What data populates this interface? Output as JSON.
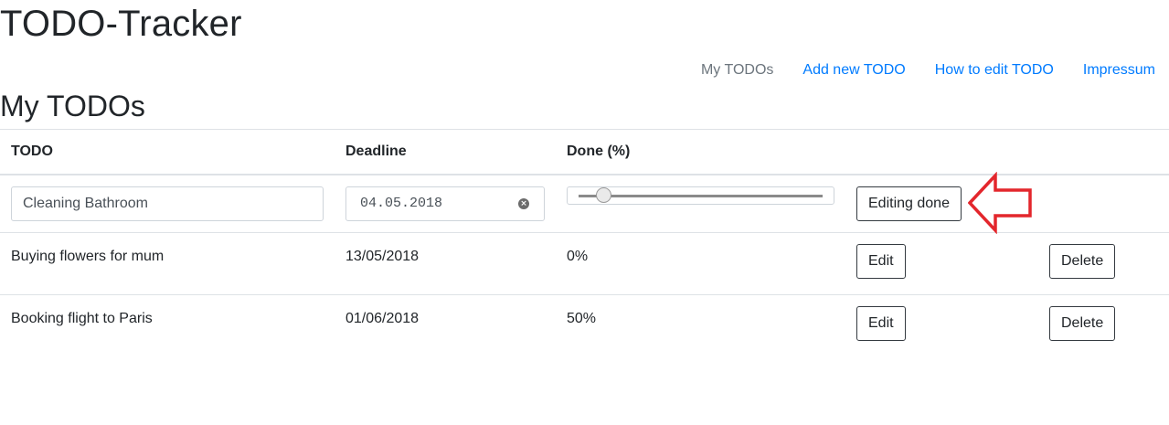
{
  "app": {
    "title": "TODO-Tracker"
  },
  "nav": {
    "items": [
      {
        "label": "My TODOs",
        "active": true
      },
      {
        "label": "Add new TODO",
        "active": false
      },
      {
        "label": "How to edit TODO",
        "active": false
      },
      {
        "label": "Impressum",
        "active": false
      }
    ]
  },
  "page": {
    "title": "My TODOs"
  },
  "table": {
    "headers": [
      "TODO",
      "Deadline",
      "Done (%)"
    ],
    "edit_row": {
      "todo_value": "Cleaning Bathroom",
      "deadline_value": "04.05.2018",
      "done_percent": 10,
      "editing_done_label": "Editing done"
    },
    "rows": [
      {
        "todo": "Buying flowers for mum",
        "deadline": "13/05/2018",
        "done": "0%",
        "edit_label": "Edit",
        "delete_label": "Delete"
      },
      {
        "todo": "Booking flight to Paris",
        "deadline": "01/06/2018",
        "done": "50%",
        "edit_label": "Edit",
        "delete_label": "Delete"
      }
    ]
  },
  "colors": {
    "link": "#007bff",
    "active_nav": "#6c757d",
    "annotation_arrow": "#e3262c",
    "border": "#dee2e6"
  },
  "icons": {
    "clear": "clear-icon",
    "arrow": "left-arrow-annotation-icon"
  }
}
